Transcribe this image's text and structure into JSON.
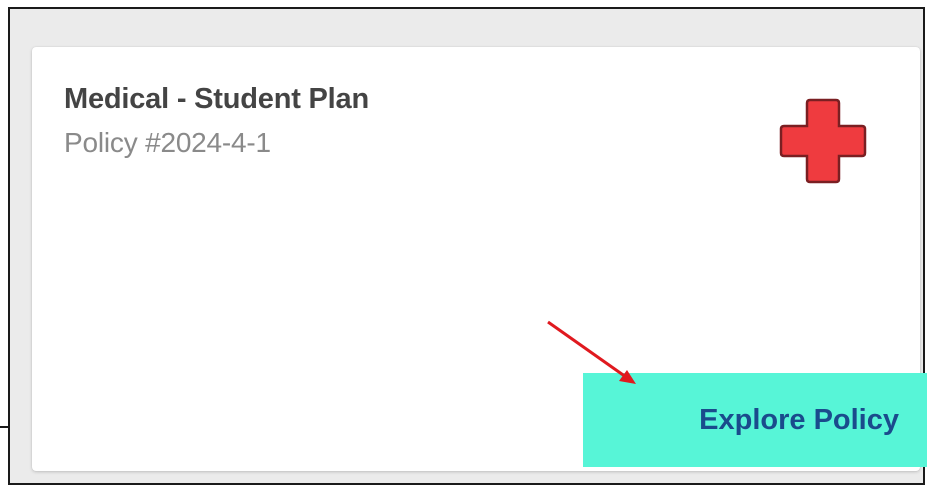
{
  "card": {
    "title": "Medical - Student Plan",
    "policy_number": "Policy #2024-4-1",
    "icon": "medical-cross-icon",
    "action_label": "Explore Policy"
  },
  "colors": {
    "cross_fill": "#ef3b3f",
    "cross_stroke": "#7a1f22",
    "button_bg": "#57f5d7",
    "button_text": "#1a4b8c",
    "arrow": "#e0191f"
  }
}
